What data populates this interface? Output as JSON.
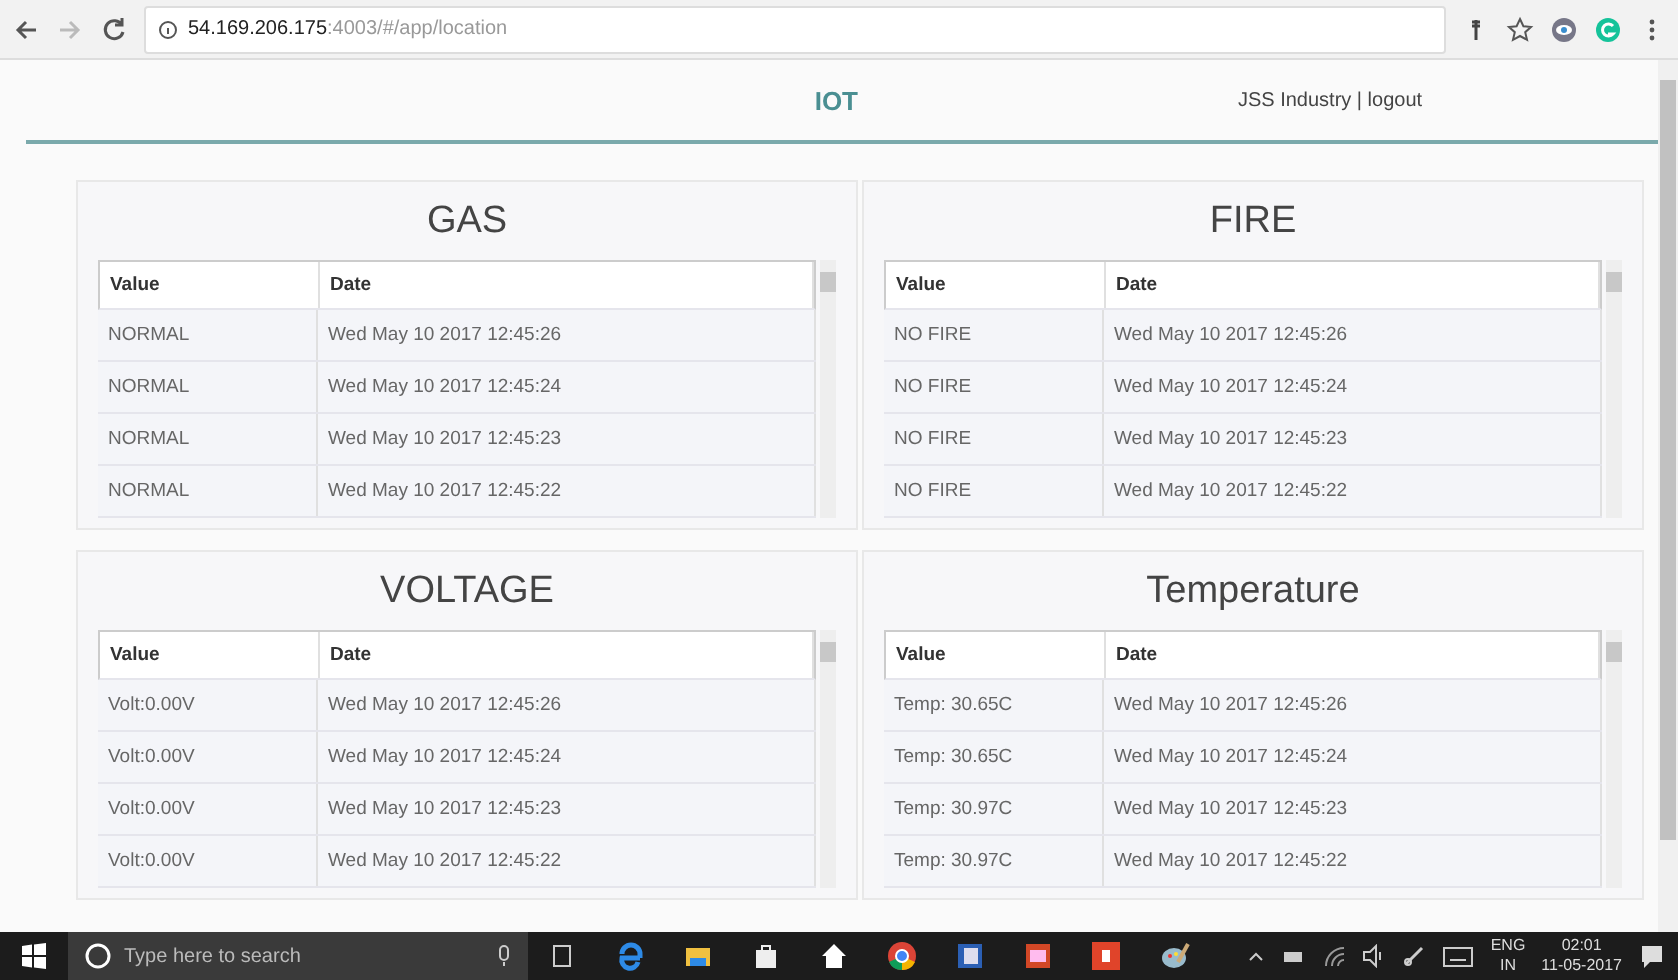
{
  "browser": {
    "url_host": "54.169.206.175",
    "url_path": ":4003/#/app/location"
  },
  "header": {
    "title": "IOT",
    "user": "JSS Industry | logout"
  },
  "panels": [
    {
      "title": "GAS",
      "columns": [
        "Value",
        "Date"
      ],
      "rows": [
        [
          "NORMAL",
          "Wed May 10 2017 12:45:26"
        ],
        [
          "NORMAL",
          "Wed May 10 2017 12:45:24"
        ],
        [
          "NORMAL",
          "Wed May 10 2017 12:45:23"
        ],
        [
          "NORMAL",
          "Wed May 10 2017 12:45:22"
        ]
      ]
    },
    {
      "title": "FIRE",
      "columns": [
        "Value",
        "Date"
      ],
      "rows": [
        [
          "NO FIRE",
          "Wed May 10 2017 12:45:26"
        ],
        [
          "NO FIRE",
          "Wed May 10 2017 12:45:24"
        ],
        [
          "NO FIRE",
          "Wed May 10 2017 12:45:23"
        ],
        [
          "NO FIRE",
          "Wed May 10 2017 12:45:22"
        ]
      ]
    },
    {
      "title": "VOLTAGE",
      "columns": [
        "Value",
        "Date"
      ],
      "rows": [
        [
          "Volt:0.00V",
          "Wed May 10 2017 12:45:26"
        ],
        [
          "Volt:0.00V",
          "Wed May 10 2017 12:45:24"
        ],
        [
          "Volt:0.00V",
          "Wed May 10 2017 12:45:23"
        ],
        [
          "Volt:0.00V",
          "Wed May 10 2017 12:45:22"
        ]
      ]
    },
    {
      "title": "Temperature",
      "columns": [
        "Value",
        "Date"
      ],
      "rows": [
        [
          "Temp: 30.65C",
          "Wed May 10 2017 12:45:26"
        ],
        [
          "Temp: 30.65C",
          "Wed May 10 2017 12:45:24"
        ],
        [
          "Temp: 30.97C",
          "Wed May 10 2017 12:45:23"
        ],
        [
          "Temp: 30.97C",
          "Wed May 10 2017 12:45:22"
        ]
      ]
    }
  ],
  "taskbar": {
    "search_placeholder": "Type here to search",
    "lang": "ENG",
    "region": "IN",
    "time": "02:01",
    "date": "11-05-2017"
  }
}
